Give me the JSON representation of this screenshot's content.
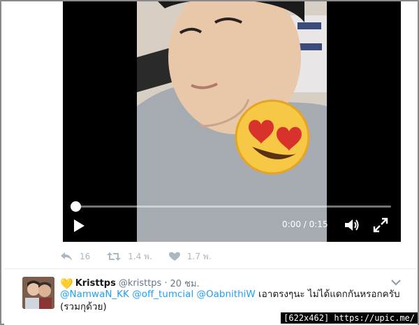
{
  "video": {
    "current_time": "0:00",
    "duration": "0:15",
    "time_separator": " / ",
    "progress": 0
  },
  "actions": {
    "reply_count": "16",
    "retweet_count": "1.4 พ.",
    "like_count": "1.7 พ."
  },
  "next_tweet": {
    "heart_emoji": "💛",
    "display_name": "Kristtps",
    "handle": "@kristtps",
    "separator": "·",
    "timestamp": "20 ชม.",
    "mentions": [
      "@NamwaN_KK",
      "@off_tumcial",
      "@OabnithiW"
    ],
    "text": " เอาตรงๆนะ ไม่ได้แดกกันหรอกครับ (รวมกุด้วย)"
  },
  "watermark": "[622x462] https://upic.me/",
  "colors": {
    "link": "#1da1f2",
    "muted": "#aab8c2",
    "text": "#14171a"
  },
  "icons": [
    "play-icon",
    "volume-icon",
    "fullscreen-icon",
    "reply-icon",
    "retweet-icon",
    "like-icon",
    "chevron-down-icon",
    "heart-eyes-emoji"
  ]
}
